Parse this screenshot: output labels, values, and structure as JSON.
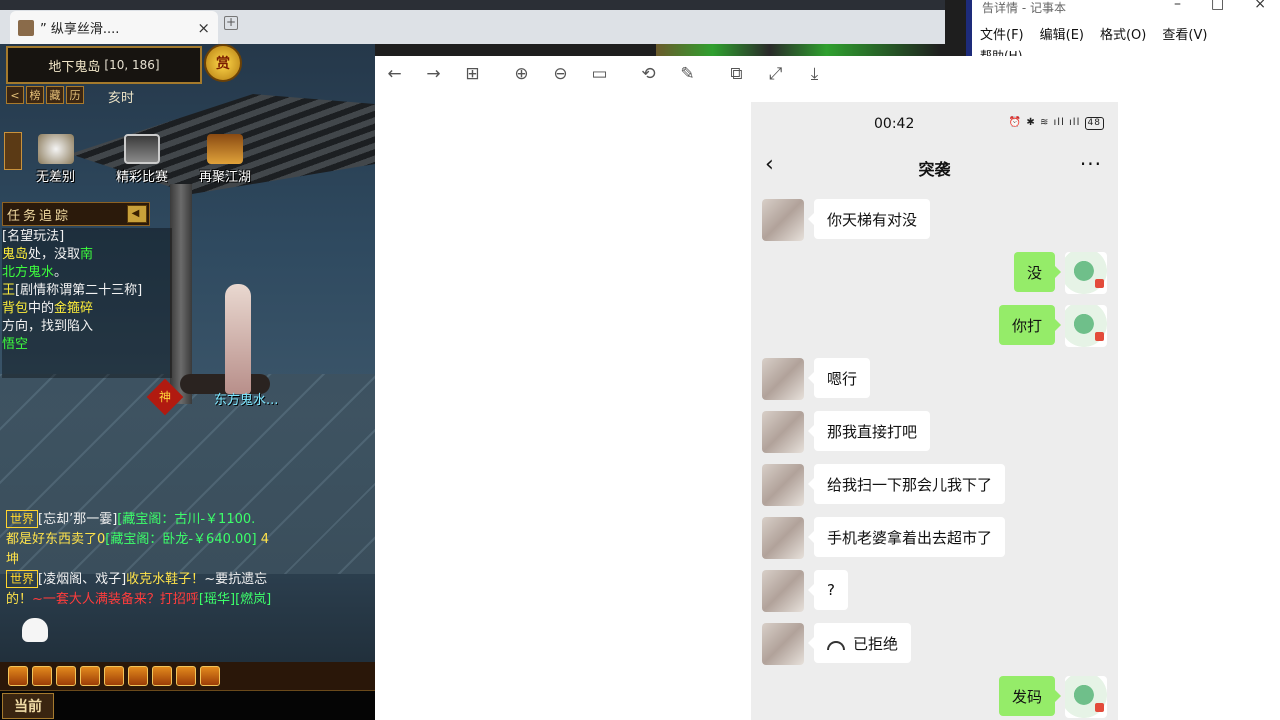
{
  "browser": {
    "tab_title": "” 纵享丝滑....",
    "close": "×",
    "new_tab": "+"
  },
  "notepad": {
    "title": "告详情 - 记事本",
    "menu": [
      "文件(F)",
      "编辑(E)",
      "格式(O)",
      "查看(V)"
    ],
    "menu_help": "帮助(H)",
    "win_min": "–",
    "win_max": "□",
    "win_close": "×"
  },
  "game": {
    "location": "地下鬼岛",
    "coords": "[10, 186]",
    "medal": "赏",
    "small_buttons": [
      "<",
      "榜",
      "藏",
      "历"
    ],
    "shichen": "亥时",
    "features": [
      "无差别",
      "精彩比赛",
      "再聚江湖"
    ],
    "task_header": "任务追踪",
    "task_toggle": "◀",
    "tasks": [
      [
        {
          "t": "[名望玩法]",
          "c": "w"
        }
      ],
      [
        {
          "t": "鬼岛",
          "c": "y"
        },
        {
          "t": "处，没取",
          "c": "w"
        },
        {
          "t": "南",
          "c": "g"
        }
      ],
      [
        {
          "t": "北方鬼水",
          "c": "g"
        },
        {
          "t": "。",
          "c": "w"
        }
      ],
      [
        {
          "t": "王",
          "c": "y"
        },
        {
          "t": "[剧情称谓第二十三称]",
          "c": "w"
        }
      ],
      [
        {
          "t": "背包",
          "c": "y"
        },
        {
          "t": "中的",
          "c": "w"
        },
        {
          "t": "金箍碎",
          "c": "y"
        }
      ],
      [
        {
          "t": "方向，找到陷入",
          "c": "w"
        }
      ],
      [
        {
          "t": "悟空",
          "c": "g"
        }
      ]
    ],
    "npc_name": "东方鬼水...",
    "shen": "神",
    "chat": [
      [
        {
          "t": "世界",
          "c": "badge"
        },
        {
          "t": "[忘却’那一霎]",
          "c": "c-w"
        },
        {
          "t": "[藏宝阁：古川-￥1100.",
          "c": "c-g"
        }
      ],
      [
        {
          "t": "都是好东西卖了0",
          "c": "c-y"
        },
        {
          "t": "[藏宝阁：卧龙-￥640.00]",
          "c": "c-g"
        },
        {
          "t": " 4",
          "c": "c-y"
        }
      ],
      [
        {
          "t": "坤",
          "c": "c-y"
        }
      ],
      [
        {
          "t": "世界",
          "c": "badge"
        },
        {
          "t": "[凌烟阁、戏子]",
          "c": "c-w"
        },
        {
          "t": "收克水鞋子！",
          "c": "c-y"
        },
        {
          "t": "~要抗遗忘",
          "c": "c-w"
        }
      ],
      [
        {
          "t": "的！",
          "c": "c-y"
        },
        {
          "t": "~一套大人满装备来？打招呼",
          "c": "c-r"
        },
        {
          "t": "[瑶华][燃岚]",
          "c": "c-g"
        }
      ]
    ],
    "input_label": "当前",
    "input_value": ""
  },
  "viewer": {
    "toolbar": [
      {
        "name": "back-icon",
        "glyph": "←"
      },
      {
        "name": "forward-icon",
        "glyph": "→"
      },
      {
        "name": "thumbnails-icon",
        "glyph": "⊞"
      },
      {
        "name": "zoom-in-icon",
        "glyph": "⊕"
      },
      {
        "name": "zoom-out-icon",
        "glyph": "⊖"
      },
      {
        "name": "actual-size-icon",
        "glyph": "▭"
      },
      {
        "name": "rotate-icon",
        "glyph": "⟲"
      },
      {
        "name": "edit-icon",
        "glyph": "✎"
      },
      {
        "name": "crop-icon",
        "glyph": "⧉"
      },
      {
        "name": "fullscreen-icon",
        "glyph": "⤢"
      },
      {
        "name": "download-icon",
        "glyph": "⤓"
      }
    ]
  },
  "phone": {
    "time": "00:42",
    "status_icons": "⏰ ✱ ≋ ıll ıll",
    "battery": "48",
    "chat_title": "突袭",
    "back": "‹",
    "more": "···",
    "messages": [
      {
        "from": "them",
        "text": "你天梯有对没"
      },
      {
        "from": "me",
        "text": "没"
      },
      {
        "from": "me",
        "text": "你打"
      },
      {
        "from": "them",
        "text": "嗯行"
      },
      {
        "from": "them",
        "text": "那我直接打吧"
      },
      {
        "from": "them",
        "text": "给我扫一下那会儿我下了"
      },
      {
        "from": "them",
        "text": "手机老婆拿着出去超市了"
      },
      {
        "from": "them",
        "text": "?"
      },
      {
        "from": "them",
        "text": "已拒绝",
        "call": true
      },
      {
        "from": "me",
        "text": "发码"
      }
    ]
  }
}
